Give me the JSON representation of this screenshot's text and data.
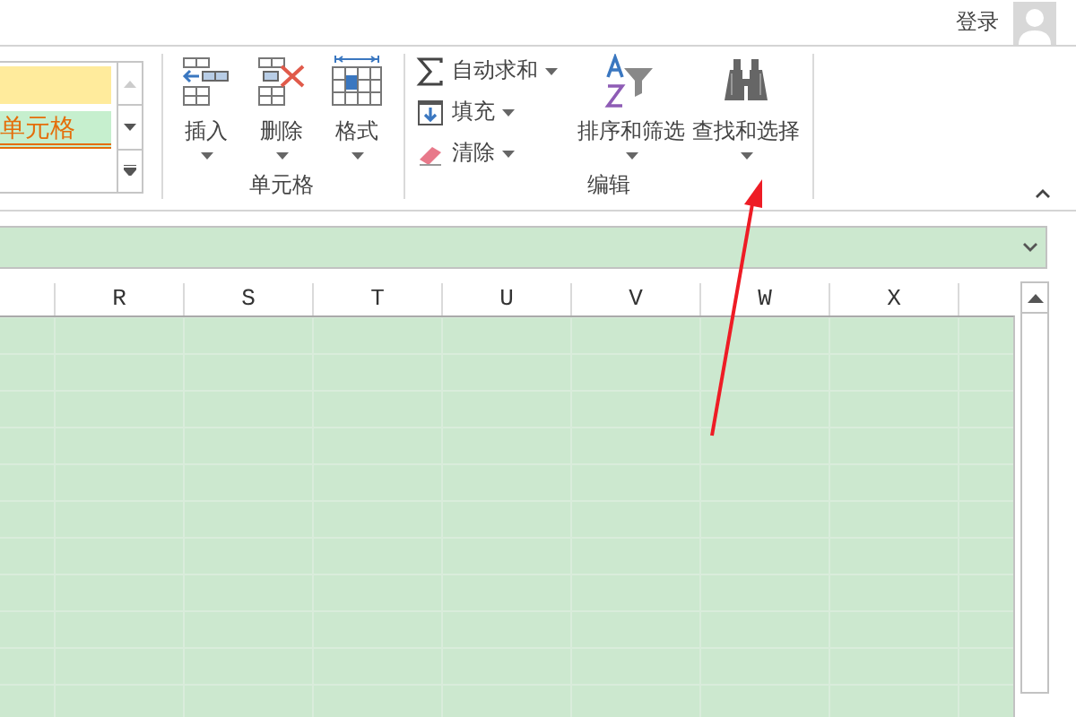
{
  "account": {
    "sign_in": "登录"
  },
  "style_gallery": {
    "cells": [
      {
        "text": "",
        "color": "#ffeb9c"
      },
      {
        "text": "单元格",
        "color": "#c6efce"
      }
    ]
  },
  "groups": [
    {
      "label": "单元格",
      "buttons": [
        {
          "kind": "large",
          "label": "插入",
          "dropdown": true
        },
        {
          "kind": "large",
          "label": "删除",
          "dropdown": true
        },
        {
          "kind": "large",
          "label": "格式",
          "dropdown": true
        }
      ]
    },
    {
      "label": "编辑",
      "buttons": [
        {
          "kind": "stack",
          "items": [
            {
              "label": "自动求和",
              "dropdown": true
            },
            {
              "label": "填充",
              "dropdown": true
            },
            {
              "label": "清除",
              "dropdown": true
            }
          ]
        },
        {
          "kind": "large",
          "label": "排序和筛选",
          "dropdown": true
        },
        {
          "kind": "large",
          "label": "查找和选择",
          "dropdown": true
        }
      ]
    }
  ],
  "columns": [
    "R",
    "S",
    "T",
    "U",
    "V",
    "W",
    "X"
  ],
  "annotation": {
    "kind": "arrow",
    "color": "#ee1c25"
  }
}
